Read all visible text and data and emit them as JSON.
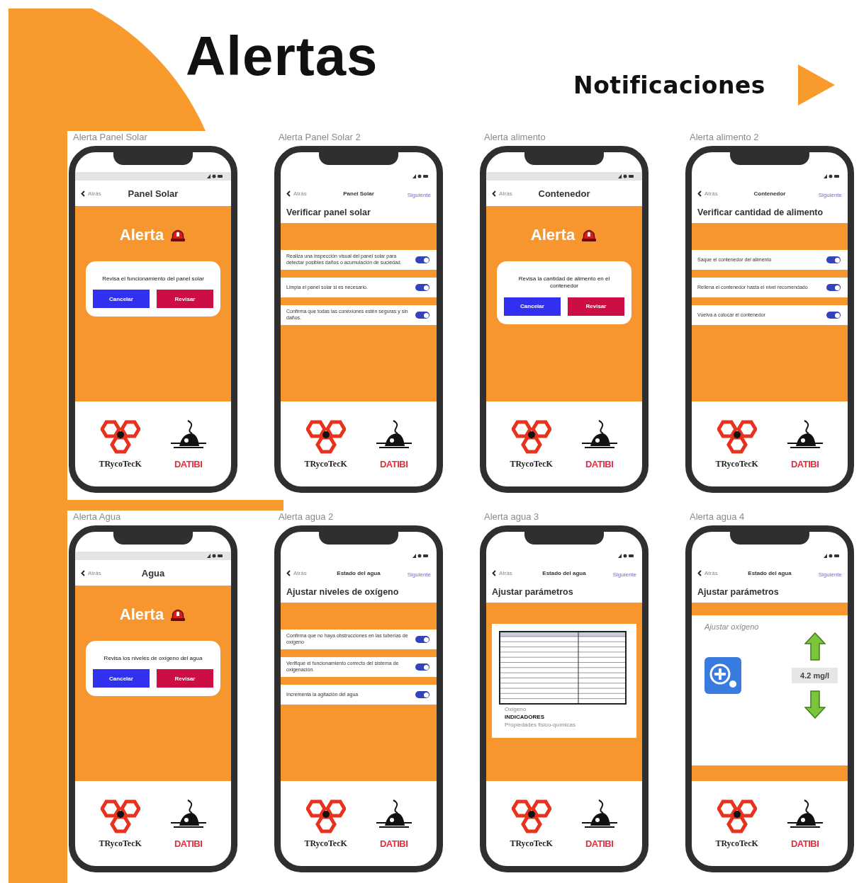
{
  "title": "Alertas",
  "subtitle": "Notificaciones",
  "screens": [
    {
      "label": "Alerta Panel Solar",
      "kind": "alert",
      "nav": {
        "back": "Atrás",
        "title": "Panel Solar"
      },
      "alert_title": "Alerta",
      "message": "Revisa el funcionamiento del panel solar",
      "buttons": [
        {
          "label": "Cancelar",
          "kind": "cancel"
        },
        {
          "label": "Revisar",
          "kind": "confirm"
        }
      ],
      "logos": [
        "TRycoTecK",
        "DATIBI"
      ]
    },
    {
      "label": "Alerta Panel Solar 2",
      "kind": "checklist",
      "nav": {
        "back": "Atrás",
        "title": "Panel Solar",
        "next": "Siguiente"
      },
      "heading": "Verificar panel solar",
      "items": [
        {
          "text": "Realiza una inspección visual del panel solar para detectar posibles daños o acumulación de suciedad.",
          "on": true
        },
        {
          "text": "Limpia el panel solar si es necesario.",
          "on": true
        },
        {
          "text": "Confirma que todas las conexiones estén seguras y sin daños.",
          "on": true
        }
      ],
      "logos": [
        "TRycoTecK",
        "DATIBI"
      ]
    },
    {
      "label": "Alerta alimento",
      "kind": "alert",
      "nav": {
        "back": "Atrás",
        "title": "Contenedor"
      },
      "alert_title": "Alerta",
      "message": "Revisa la cantidad de alimento en el contenedor",
      "buttons": [
        {
          "label": "Cancelar",
          "kind": "cancel"
        },
        {
          "label": "Revisar",
          "kind": "confirm"
        }
      ],
      "logos": [
        "TRycoTecK",
        "DATIBI"
      ]
    },
    {
      "label": "Alerta alimento 2",
      "kind": "checklist",
      "nav": {
        "back": "Atrás",
        "title": "Contenedor",
        "next": "Siguiente"
      },
      "heading": "Verificar cantidad de alimento",
      "items": [
        {
          "text": "Saque el contenedor del alimento",
          "on": true
        },
        {
          "text": "Rellena el contenedor hasta el nivel recomendado",
          "on": true
        },
        {
          "text": "Vuelva a colocar el contenedor",
          "on": true
        }
      ],
      "logos": [
        "TRycoTecK",
        "DATIBI"
      ]
    },
    {
      "label": "Alerta Agua",
      "kind": "alert",
      "nav": {
        "back": "Atrás",
        "title": "Agua"
      },
      "alert_title": "Alerta",
      "message": "Revisa los niveles de oxígeno del agua",
      "buttons": [
        {
          "label": "Cancelar",
          "kind": "cancel"
        },
        {
          "label": "Revisar",
          "kind": "confirm"
        }
      ],
      "logos": [
        "TRycoTecK",
        "DATIBI"
      ]
    },
    {
      "label": "Alerta agua 2",
      "kind": "checklist",
      "nav": {
        "back": "Atrás",
        "title": "Estado del agua",
        "next": "Siguiente"
      },
      "heading": "Ajustar niveles de oxígeno",
      "items": [
        {
          "text": "Confirma que no haya obstrucciones en las tuberías de oxígeno",
          "on": true
        },
        {
          "text": "Verifique el funcionamiento correcto del sistema de oxigenación.",
          "on": true
        },
        {
          "text": "Incrementa la agitación del agua",
          "on": true
        }
      ],
      "logos": [
        "TRycoTecK",
        "DATIBI"
      ]
    },
    {
      "label": "Alerta agua 3",
      "kind": "table",
      "nav": {
        "back": "Atrás",
        "title": "Estado del agua",
        "next": "Siguiente"
      },
      "heading": "Ajustar parámetros",
      "caption": "Oxígeno",
      "caption_title": "INDICADORES",
      "caption_sub": "Propiedades fisico-químicas",
      "logos": [
        "TRycoTecK",
        "DATIBI"
      ]
    },
    {
      "label": "Alerta agua 4",
      "kind": "oxygen",
      "nav": {
        "back": "Atrás",
        "title": "Estado del agua",
        "next": "Siguiente"
      },
      "heading": "Ajustar parámetros",
      "card_title": "Ajustar oxígeno",
      "value": "4.2 mg/l",
      "logos": [
        "TRycoTecK",
        "DATIBI"
      ]
    }
  ]
}
